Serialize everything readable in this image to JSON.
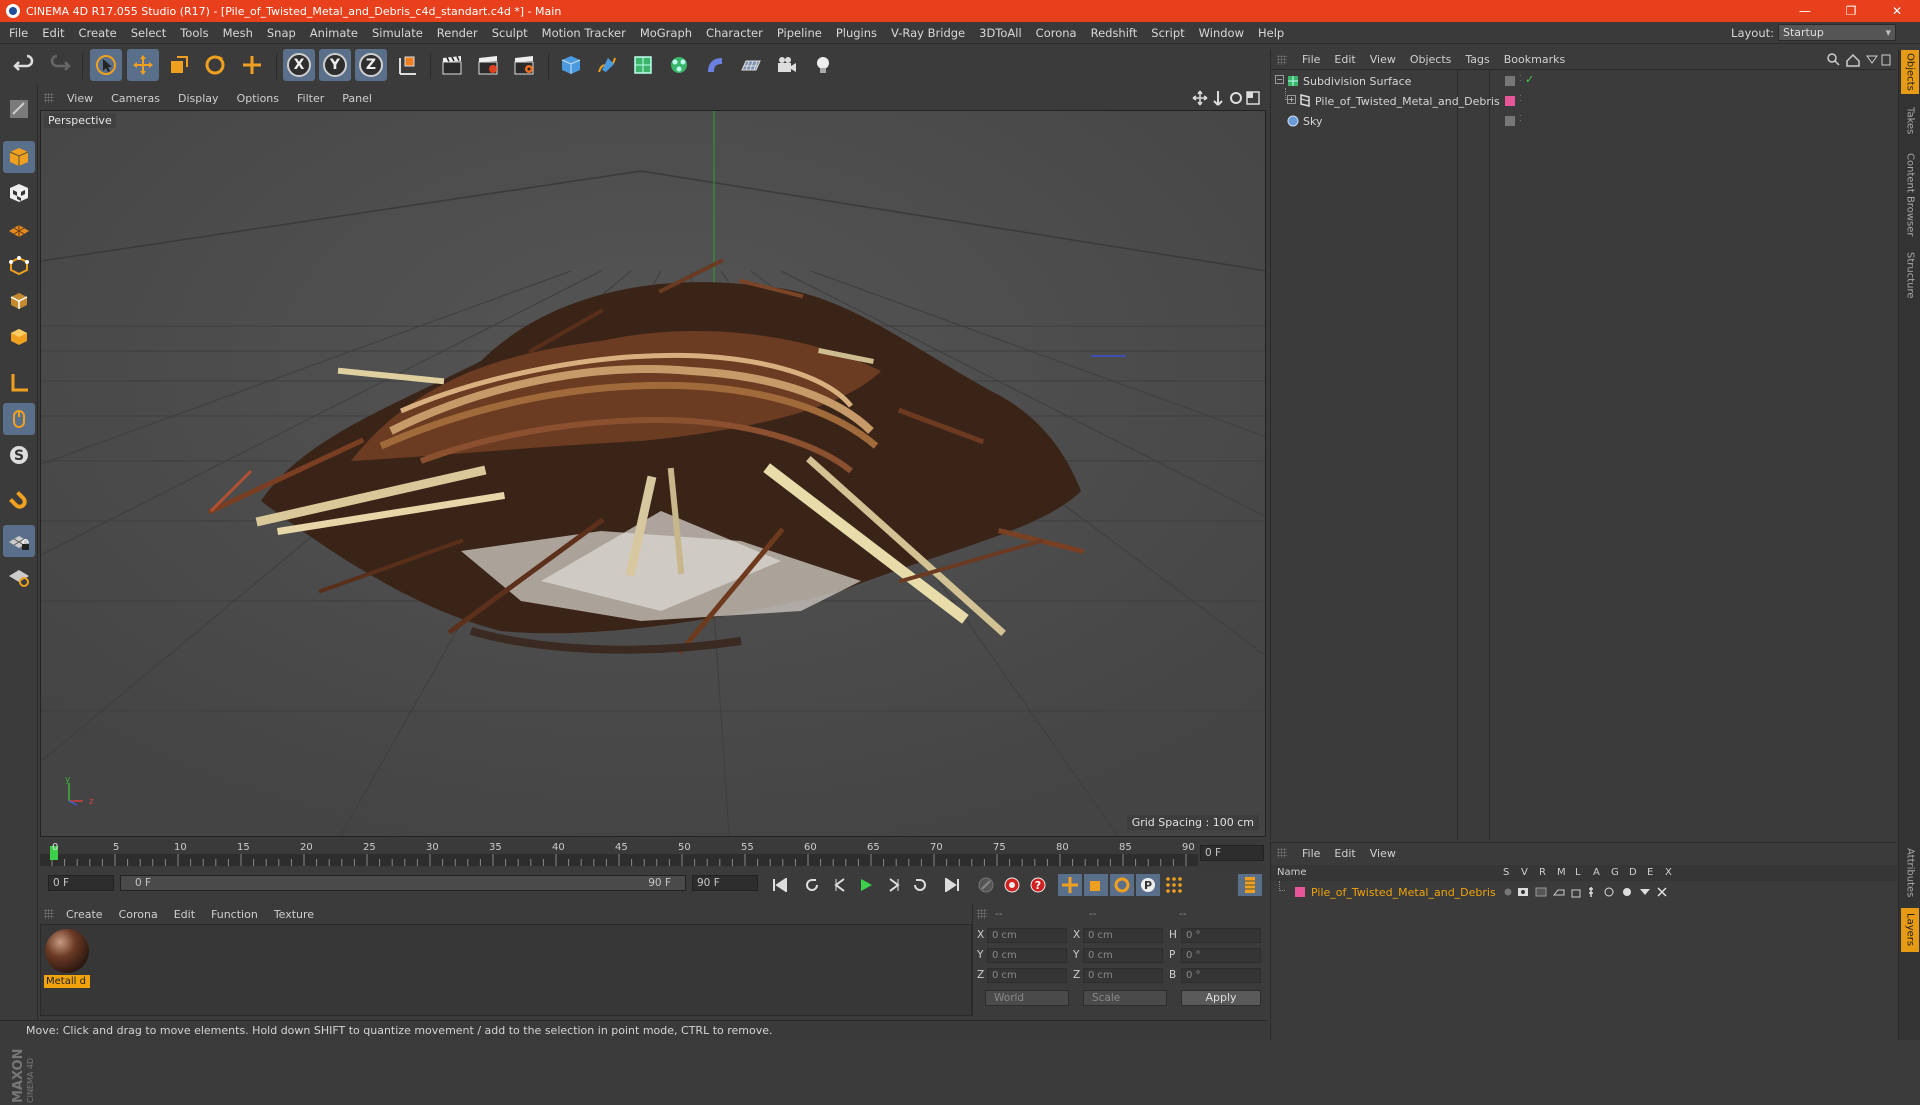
{
  "window": {
    "title": "CINEMA 4D R17.055 Studio (R17) - [Pile_of_Twisted_Metal_and_Debris_c4d_standart.c4d *] - Main",
    "minimize": "—",
    "restore": "❐",
    "close": "✕"
  },
  "menu": {
    "items": [
      "File",
      "Edit",
      "Create",
      "Select",
      "Tools",
      "Mesh",
      "Snap",
      "Animate",
      "Simulate",
      "Render",
      "Sculpt",
      "Motion Tracker",
      "MoGraph",
      "Character",
      "Pipeline",
      "Plugins",
      "V-Ray Bridge",
      "3DToAll",
      "Corona",
      "Redshift",
      "Script",
      "Window",
      "Help"
    ],
    "layout_label": "Layout:",
    "layout_value": "Startup"
  },
  "toolbar": {
    "axis_x": "X",
    "axis_y": "Y",
    "axis_z": "Z"
  },
  "viewport": {
    "menu": [
      "View",
      "Cameras",
      "Display",
      "Options",
      "Filter",
      "Panel"
    ],
    "label": "Perspective",
    "grid_spacing": "Grid Spacing : 100 cm",
    "axis_y": "y",
    "axis_z": "z",
    "accent": "#3ea83e"
  },
  "timeline": {
    "ticks": [
      "0",
      "5",
      "10",
      "15",
      "20",
      "25",
      "30",
      "35",
      "40",
      "45",
      "50",
      "55",
      "60",
      "65",
      "70",
      "75",
      "80",
      "85",
      "90"
    ],
    "current_frame": "0 F",
    "start_field": "0 F",
    "range_start": "0 F",
    "range_end": "90 F",
    "end_field": "90 F"
  },
  "materials": {
    "menu": [
      "Create",
      "Corona",
      "Edit",
      "Function",
      "Texture"
    ],
    "items": [
      {
        "name": "Metall d"
      }
    ]
  },
  "coordinates": {
    "header": [
      "--",
      "--",
      "--"
    ],
    "rows": [
      {
        "l1": "X",
        "v1": "0 cm",
        "l2": "X",
        "v2": "0 cm",
        "l3": "H",
        "v3": "0 °"
      },
      {
        "l1": "Y",
        "v1": "0 cm",
        "l2": "Y",
        "v2": "0 cm",
        "l3": "P",
        "v3": "0 °"
      },
      {
        "l1": "Z",
        "v1": "0 cm",
        "l2": "Z",
        "v2": "0 cm",
        "l3": "B",
        "v3": "0 °"
      }
    ],
    "space": "World",
    "mode": "Scale",
    "apply": "Apply"
  },
  "objects": {
    "menu": [
      "File",
      "Edit",
      "View",
      "Objects",
      "Tags",
      "Bookmarks"
    ],
    "items": [
      {
        "name": "Subdivision Surface",
        "icon": "subdivision-icon"
      },
      {
        "name": "Pile_of_Twisted_Metal_and_Debris",
        "icon": "polygon-object-icon"
      },
      {
        "name": "Sky",
        "icon": "sky-icon"
      }
    ]
  },
  "layers": {
    "menu": [
      "File",
      "Edit",
      "View"
    ],
    "columns": [
      "Name",
      "S",
      "V",
      "R",
      "M",
      "L",
      "A",
      "G",
      "D",
      "E",
      "X"
    ],
    "items": [
      {
        "name": "Pile_of_Twisted_Metal_and_Debris",
        "color": "#e8569a"
      }
    ]
  },
  "side_tabs": [
    "Objects",
    "Takes",
    "Content Browser",
    "Structure",
    "Attributes",
    "Layers"
  ],
  "status": "Move: Click and drag to move elements. Hold down SHIFT to quantize movement / add to the selection in point mode, CTRL to remove.",
  "colors": {
    "title_bar": "#e8401c",
    "selection": "#5a6f8a",
    "material_label": "#f0a30a",
    "layer_name": "#f0a30a"
  }
}
